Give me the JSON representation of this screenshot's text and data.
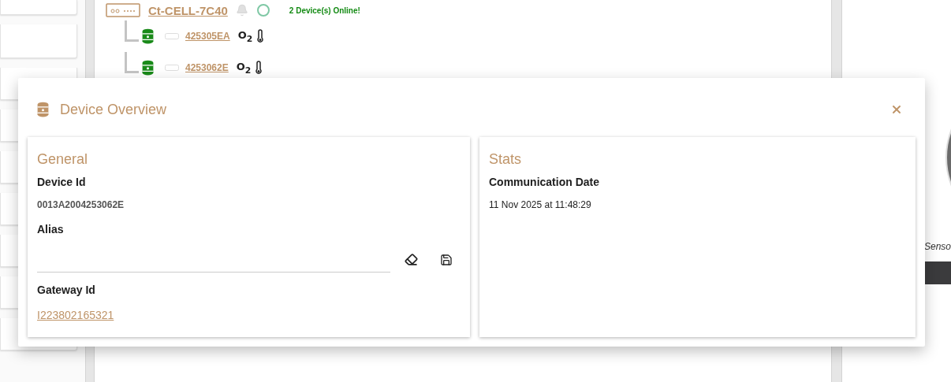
{
  "background": {
    "gateway": {
      "name": "Ct-CELL-7C40",
      "status": "2 Device(s) Online!"
    },
    "devices": [
      {
        "id": "425305EA",
        "gas": "O$_{2}$"
      },
      {
        "id": "4253062E",
        "gas": "O$_{2}$"
      }
    ],
    "side_caption": "Senso"
  },
  "dialog": {
    "title": "Device Overview",
    "cards": [
      {
        "title": "General",
        "fields": [
          {
            "kind": "code",
            "label": "Device Id",
            "value": "0013A2004253062E"
          },
          {
            "kind": "input",
            "label": "Alias"
          },
          {
            "kind": "link",
            "label": "Gateway Id",
            "value": "I223802165321"
          }
        ]
      },
      {
        "title": "Stats",
        "fields": [
          {
            "kind": "text",
            "label": "Communication Date",
            "value": "11 Nov 2025 at 11:48:29"
          }
        ]
      }
    ]
  }
}
